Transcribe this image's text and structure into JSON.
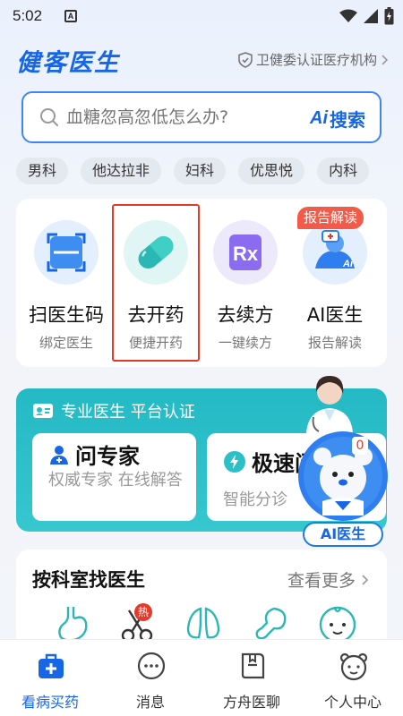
{
  "status_bar": {
    "time": "5:02",
    "notification_letter": "A"
  },
  "header": {
    "brand": "健客医生",
    "certification": "卫健委认证医疗机构"
  },
  "search": {
    "placeholder": "血糖忽高忽低怎么办?",
    "ai_label": "Ai",
    "ai_search_label": "搜索"
  },
  "chips": [
    "男科",
    "他达拉非",
    "妇科",
    "优思悦",
    "内科"
  ],
  "services": [
    {
      "title": "扫医生码",
      "subtitle": "绑定医生",
      "icon": "scan-icon"
    },
    {
      "title": "去开药",
      "subtitle": "便捷开药",
      "icon": "pill-icon"
    },
    {
      "title": "去续方",
      "subtitle": "一键续方",
      "icon": "rx-icon"
    },
    {
      "title": "AI医生",
      "subtitle": "报告解读",
      "icon": "ai-doctor-icon"
    }
  ],
  "report_badge": "报告解读",
  "expert": {
    "header": "专业医生 平台认证",
    "ask_title": "问专家",
    "ask_desc": "权威专家 在线解答",
    "fast_title": "极速问",
    "fast_desc": "智能分诊",
    "ai_doctor_label": "AI医生",
    "unread_count": "0"
  },
  "department": {
    "title": "按科室找医生",
    "more": "查看更多",
    "hot_tag": "热"
  },
  "tabbar": [
    {
      "label": "看病买药",
      "icon": "medkit-icon",
      "active": true
    },
    {
      "label": "消息",
      "icon": "chat-icon",
      "active": false
    },
    {
      "label": "方舟医聊",
      "icon": "book-icon",
      "active": false
    },
    {
      "label": "个人中心",
      "icon": "bear-face-icon",
      "active": false
    }
  ],
  "colors": {
    "primary": "#1766e6",
    "teal": "#2bbfc8",
    "badge_red": "#f15b4a",
    "highlight_red": "#e23b2b"
  }
}
